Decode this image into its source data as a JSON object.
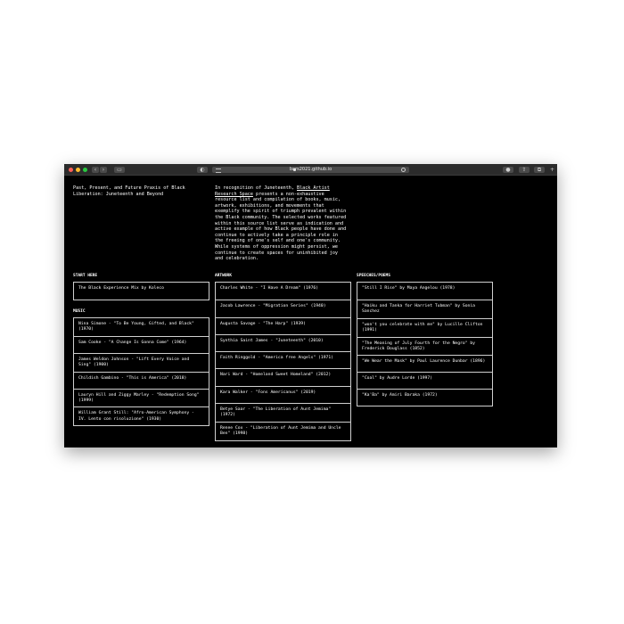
{
  "browser": {
    "url": "bars2021.github.io"
  },
  "page": {
    "title": "Past, Present, and Future Praxis of Black Liberation: Juneteenth and Beyond",
    "intro_prefix": "In recognition of Juneteenth, ",
    "intro_link": "Black Artist Research Space",
    "intro_suffix": " presents a non-exhaustive resource list and compilation of books, music, artwork, exhibitions, and movements that exemplify the spirit of triumph prevalent within the Black community. The selected works featured within this source list serve as indication and active example of how Black people have done and continue to actively take a principle role in the freeing of one's self and one's community. While systems of oppression might persist, we continue to create spaces for uninhibited joy and celebration."
  },
  "start_here": {
    "heading": "START HERE",
    "items": [
      "The Black Experience Mix by Koleco"
    ]
  },
  "music": {
    "heading": "MUSIC",
    "items": [
      "Nina Simone - \"To Be Young, Gifted, and Black\" (1970)",
      "Sam Cooke - \"A Change Is Gonna Come\" (1964)",
      "James Weldon Johnson - \"Lift Every Voice and Sing\" (1900)",
      "Childish Gambino - \"This is America\" (2018)",
      "Lauryn Hill and Ziggy Marley - \"Redemption Song\" (1999)",
      "William Grant Still: \"Afro-American Symphony - IV. Lento con risoluzione\" (1930)"
    ]
  },
  "artwork": {
    "heading": "ARTWORK",
    "items": [
      "Charles White - \"I Have A Dream\" (1976)",
      "Jacob Lawrence - \"Migration Series\" (1940)",
      "Augusta Savage - \"The Harp\" (1939)",
      "Synthia Saint James - \"Juneteenth\" (2010)",
      "Faith Ringgold - \"America free Angels\" (1971)",
      "Nari Ward - \"Homeland Sweet Homeland\" (2012)",
      "Kara Walker - \"Fons Americanus\" (2019)",
      "Betye Saar - \"The Liberation of Aunt Jemima\" (1972)",
      "Renee Cox - \"Liberation of Aunt Jemima and Uncle Ben\" (1998)"
    ]
  },
  "speeches": {
    "heading": "SPEECHES/POEMS",
    "items": [
      "\"Still I Rise\" by Maya Angelou (1978)",
      "\"Haiku and Tanka for Harriet Tubman\" by Sonia Sanchez",
      "\"won't you celebrate with me\" by Lucille Clifton (1991)",
      "\"The Meaning of July Fourth for the Negro\" by Frederick Douglass (1852)",
      "\"We Wear the Mask\" by Paul Laurence Dunbar (1896)",
      "\"Coal\" by Audre Lorde (1997)",
      "\"Ka'Ba\" by Amiri Baraka (1972)"
    ]
  }
}
